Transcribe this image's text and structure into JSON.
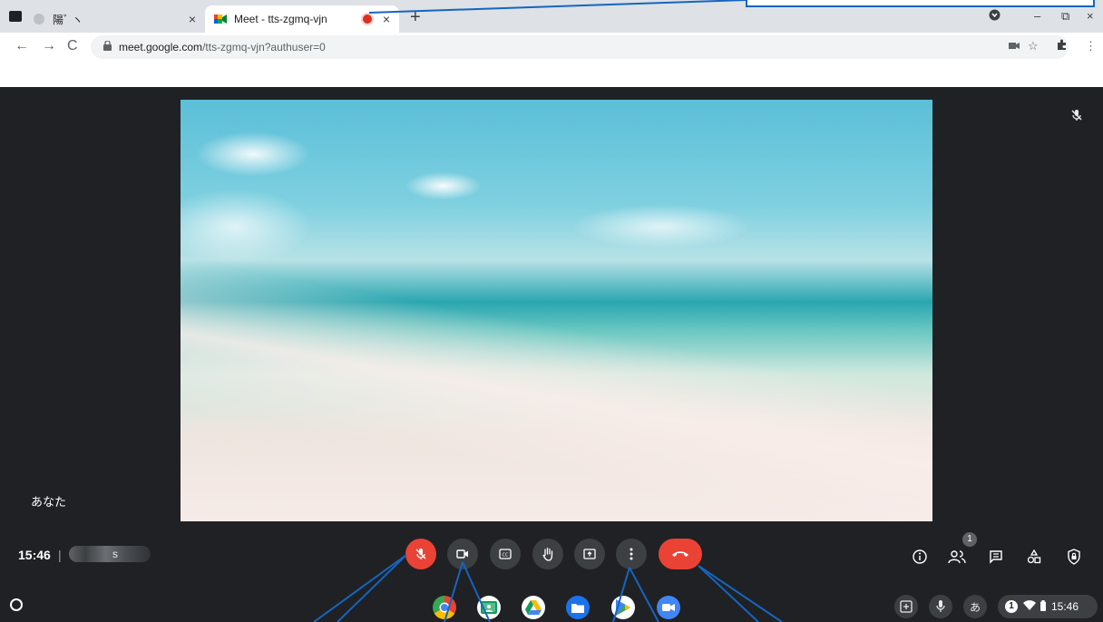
{
  "browser": {
    "tabs": [
      {
        "title": "陽ﾞ ヽ",
        "close": "×"
      },
      {
        "title": "Meet - tts-zgmq-vjn",
        "close": "×"
      }
    ],
    "new_tab": "+",
    "url_host": "meet.google.com",
    "url_path": "/tts-zgmq-vjn?authuser=0",
    "window_controls": {
      "minimize": "–",
      "restore": "⧉",
      "close": "×"
    }
  },
  "meet": {
    "self_label": "あなた",
    "clock": "15:46",
    "separator": "|",
    "meeting_code_partial": "s",
    "participants_count": "1"
  },
  "shelf": {
    "ime_label": "あ",
    "notification_count": "1",
    "time": "15:46"
  },
  "colors": {
    "end_call": "#ea4335",
    "muted_mic": "#ea4335",
    "annotation": "#1565c0"
  }
}
